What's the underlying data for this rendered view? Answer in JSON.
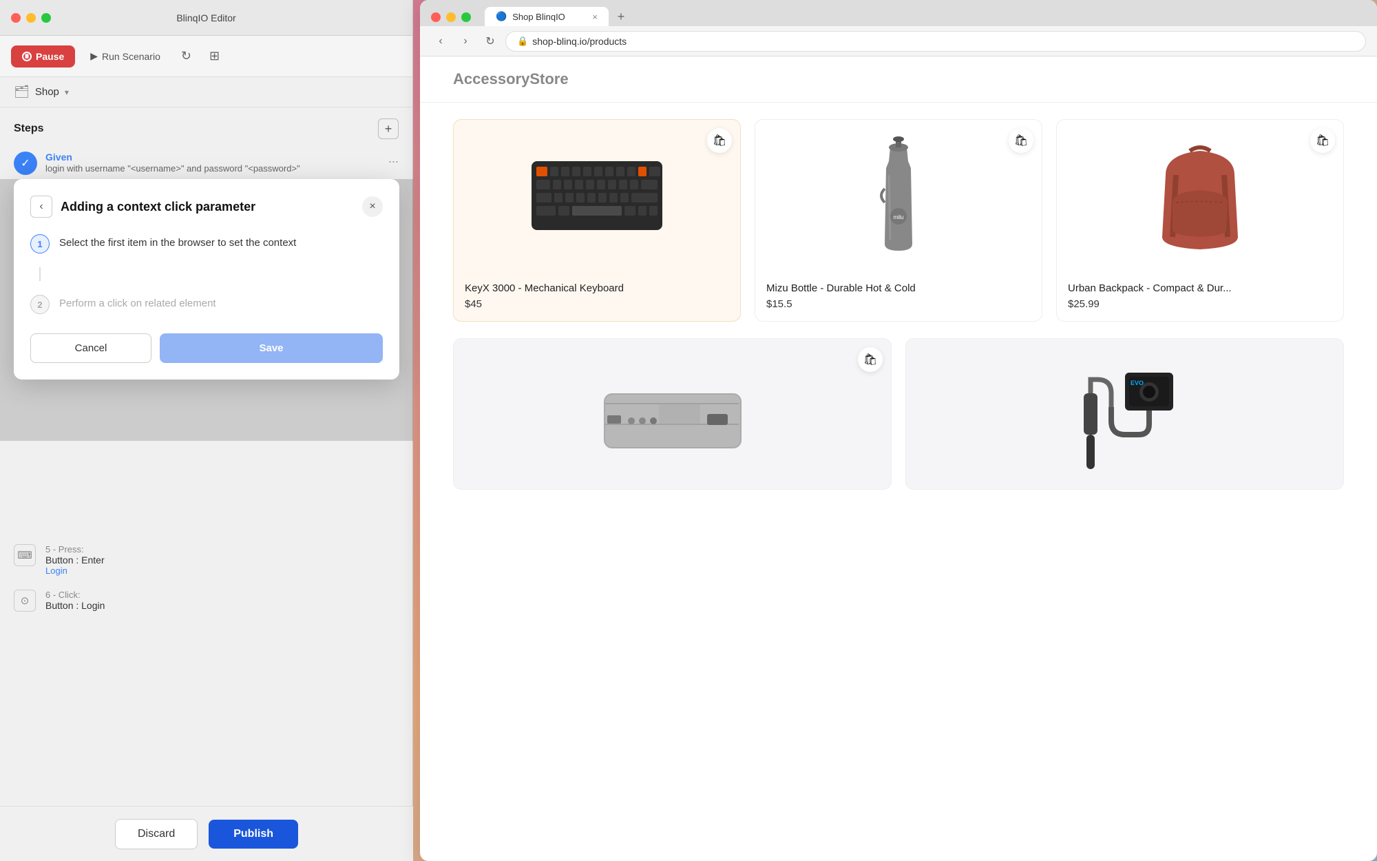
{
  "editor": {
    "title": "BlinqIO Editor",
    "toolbar": {
      "pause_label": "Pause",
      "run_label": "Run Scenario",
      "context": "Shop",
      "context_chevron": "▾"
    },
    "steps": {
      "title": "Steps",
      "add_btn": "+",
      "given": {
        "label": "Given",
        "description": "login with username \"<username>\" and password \"<password>\"",
        "more": "..."
      }
    },
    "modal": {
      "title": "Adding a context click parameter",
      "back_label": "‹",
      "close_label": "×",
      "steps": [
        {
          "num": "1",
          "text": "Select the first item in the browser to set the context",
          "active": true
        },
        {
          "num": "2",
          "text": "Perform a click on related element",
          "active": false
        }
      ],
      "cancel_label": "Cancel",
      "save_label": "Save"
    },
    "bottom_steps": [
      {
        "icon": "⌨",
        "number": "5",
        "action_label": "5 - Press:",
        "action": "Button : Enter",
        "link": "Login"
      },
      {
        "icon": "⊙",
        "number": "6",
        "action_label": "6 - Click:",
        "action": "Button : Login",
        "link": ""
      }
    ],
    "footer": {
      "discard_label": "Discard",
      "publish_label": "Publish"
    }
  },
  "browser": {
    "tab_title": "Shop BlinqIO",
    "tab_close": "×",
    "new_tab": "+",
    "nav": {
      "back": "‹",
      "forward": "›",
      "reload": "↻"
    },
    "address": "shop-blinq.io/products",
    "store": {
      "logo_part1": "Accessory",
      "logo_part2": "Store"
    },
    "products": [
      {
        "name": "KeyX 3000 - Mechanical Keyboard",
        "price": "$45",
        "bg": "highlighted",
        "type": "keyboard"
      },
      {
        "name": "Mizu Bottle - Durable Hot & Cold",
        "price": "$15.5",
        "bg": "normal",
        "type": "bottle"
      },
      {
        "name": "Urban Backpack - Compact & Dur...",
        "price": "$25.99",
        "bg": "normal",
        "type": "backpack"
      }
    ],
    "products_row2": [
      {
        "type": "powerbank",
        "bg": "light-blue"
      },
      {
        "type": "gimbal",
        "bg": "normal"
      }
    ]
  }
}
